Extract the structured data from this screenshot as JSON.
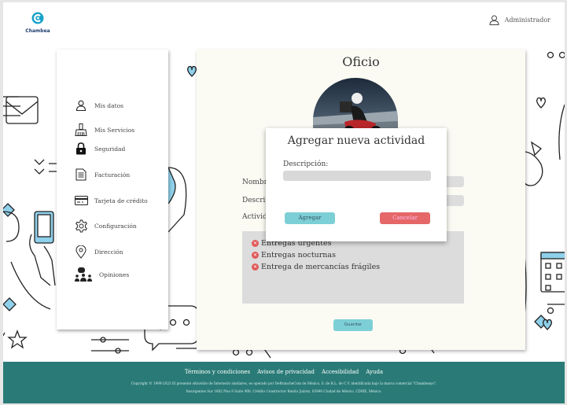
{
  "brand": {
    "name": "Chambea",
    "color": "#1c3b6e"
  },
  "header": {
    "user_label": "Administrador",
    "user_icon": "user-icon"
  },
  "sidebar": {
    "items": [
      {
        "label": "Mis datos",
        "icon": "user-icon"
      },
      {
        "label": "Mis Servicios",
        "icon": "broom-icon"
      },
      {
        "label": "Seguridad",
        "icon": "lock-icon"
      },
      {
        "label": "Facturación",
        "icon": "document-icon"
      },
      {
        "label": "Tarjeta de crédito",
        "icon": "credit-card-icon"
      },
      {
        "label": "Configuración",
        "icon": "gear-icon"
      },
      {
        "label": "Dirección",
        "icon": "location-pin-icon"
      },
      {
        "label": "Opiniones",
        "icon": "people-icon"
      }
    ]
  },
  "main": {
    "title": "Oficio",
    "fields": {
      "name_label": "Nombr",
      "description_label": "Descrip",
      "activities_label": "Activid"
    },
    "activities": [
      "Entregas urgentes",
      "Entregas nocturnas",
      "Entrega de mercancías frágiles"
    ],
    "save_label": "Guardar"
  },
  "modal": {
    "title": "Agregar nueva actividad",
    "description_label": "Descripción:",
    "description_value": "",
    "add_label": "Agregar",
    "cancel_label": "Cancelar"
  },
  "footer": {
    "links": [
      "Términos y condiciones",
      "Avisos de privacidad",
      "Accesibilidad",
      "Ayuda"
    ],
    "copyright": "Copyright © 1999-2023 El presente sitio/sitio de Internet/o similares, es operado por DeBrancheCom de México, S. de R.L. de C.V. identificada bajo la marca comercial \"Chambeayo\".",
    "address": "Insurgentes Sur 1602 Piso 9 Suite 900, Crédito Constructor Benito Juárez, 03940 Ciudad de México, CDMX, México."
  },
  "colors": {
    "accent": "#7dcfd6",
    "danger": "#e56767",
    "footer": "#2a7b77",
    "panel": "#fbfbf4"
  }
}
